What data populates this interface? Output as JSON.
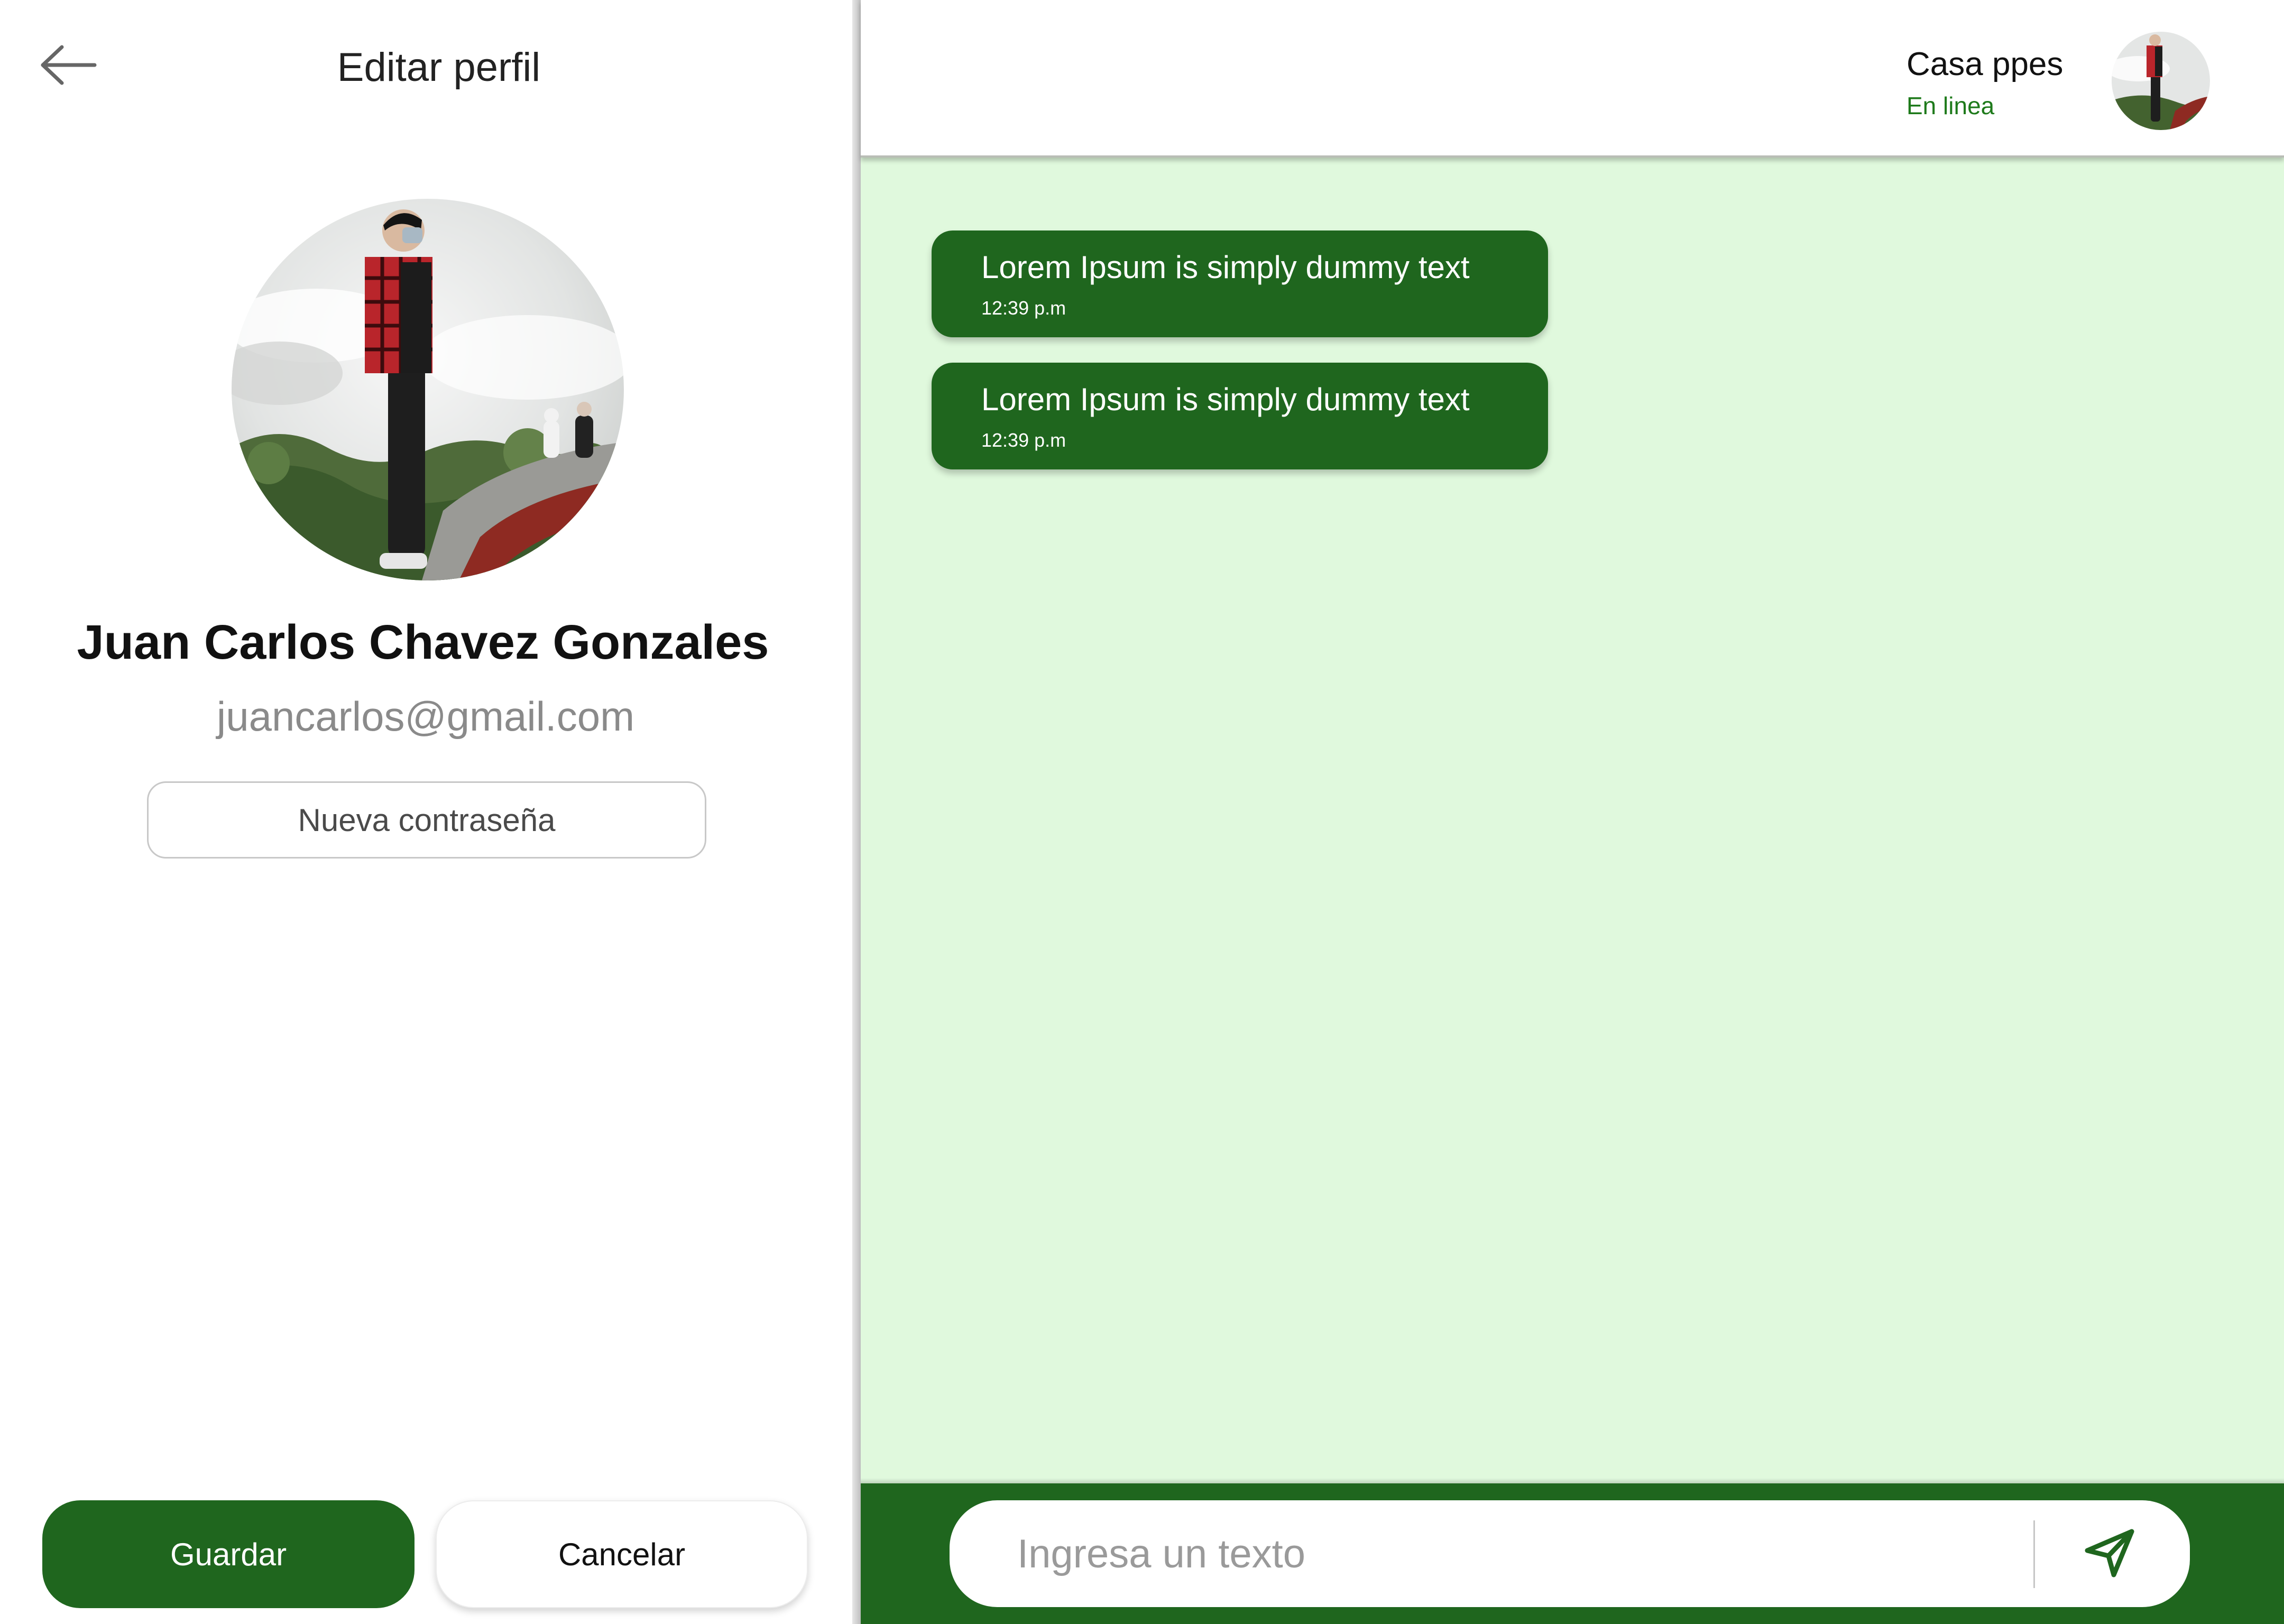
{
  "profile_panel": {
    "title": "Editar perfil",
    "name": "Juan Carlos Chavez Gonzales",
    "email": "juancarlos@gmail.com",
    "new_password_label": "Nueva contraseña",
    "save_label": "Guardar",
    "cancel_label": "Cancelar",
    "back_icon": "arrow-left-icon"
  },
  "chat": {
    "contact_name": "Casa ppes",
    "contact_status": "En linea",
    "messages": [
      {
        "text": "Lorem Ipsum is simply dummy text",
        "time": "12:39 p.m"
      },
      {
        "text": "Lorem Ipsum is simply dummy text",
        "time": "12:39 p.m"
      }
    ],
    "input_placeholder": "Ingresa un texto",
    "send_icon": "send-icon"
  },
  "colors": {
    "accent": "#1f661e",
    "chat_background": "#e0f9dd",
    "status_online": "#1e7a1b"
  }
}
